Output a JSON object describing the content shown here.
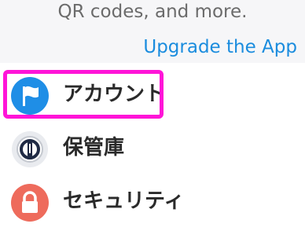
{
  "promo": {
    "text": "QR codes, and more.",
    "upgrade_link": "Upgrade the App"
  },
  "menu": [
    {
      "label": "アカウント",
      "icon": "flag-icon",
      "icon_color": "#1f8ee6",
      "highlighted": true
    },
    {
      "label": "保管庫",
      "icon": "vault-icon",
      "icon_color": "#e9ebef"
    },
    {
      "label": "セキュリティ",
      "icon": "lock-icon",
      "icon_color": "#ee6b5c"
    }
  ],
  "highlight_color": "#ff14d8"
}
